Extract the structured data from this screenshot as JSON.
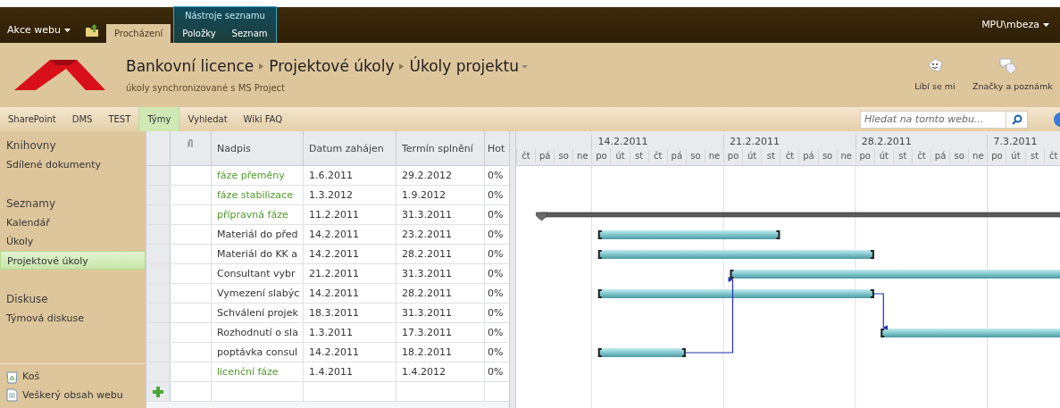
{
  "ribbon": {
    "site_actions": "Akce webu",
    "tabs": [
      {
        "label": "Procházení",
        "selected": true
      },
      {
        "label": "Položky",
        "selected": false
      },
      {
        "label": "Seznam",
        "selected": false
      }
    ],
    "tool_group": "Nástroje seznamu",
    "user": "MPU\\mbeza"
  },
  "header": {
    "breadcrumb": [
      "Bankovní licence",
      "Projektové úkoly",
      "Úkoly projektu"
    ],
    "subtitle": "úkoly synchronizované s MS Project",
    "actions": [
      "Líbí se mi",
      "Značky a poznámk"
    ]
  },
  "top_nav": {
    "items": [
      {
        "label": "SharePoint",
        "selected": false
      },
      {
        "label": "DMS",
        "selected": false
      },
      {
        "label": "TEST",
        "selected": false
      },
      {
        "label": "Týmy",
        "selected": true
      },
      {
        "label": "Vyhledat",
        "selected": false
      },
      {
        "label": "Wiki FAQ",
        "selected": false
      }
    ],
    "search": {
      "placeholder": "Hledat na tomto webu..."
    }
  },
  "sidebar": {
    "sections": [
      {
        "heading": "Knihovny",
        "items": [
          {
            "label": "Sdílené dokumenty",
            "selected": false
          }
        ]
      },
      {
        "heading": "Seznamy",
        "items": [
          {
            "label": "Kalendář",
            "selected": false
          },
          {
            "label": "Úkoly",
            "selected": false
          },
          {
            "label": "Projektové úkoly",
            "selected": true
          }
        ]
      },
      {
        "heading": "Diskuse",
        "items": [
          {
            "label": "Týmová diskuse",
            "selected": false
          }
        ]
      }
    ],
    "footer": [
      {
        "label": "Koš",
        "kind": "bin"
      },
      {
        "label": "Veškerý obsah webu",
        "kind": "document"
      }
    ]
  },
  "table": {
    "columns": [
      "Nadpis",
      "Datum zahájen",
      "Termín splnění",
      "Hot"
    ],
    "rows": [
      {
        "kind": "summary",
        "title": "fáze přeměny",
        "start": "1.6.2011",
        "due": "29.2.2012",
        "done": "0%"
      },
      {
        "kind": "summary",
        "title": "fáze stabilizace",
        "start": "1.3.2012",
        "due": "1.9.2012",
        "done": "0%"
      },
      {
        "kind": "summary",
        "title": "přípravná fáze",
        "start": "11.2.2011",
        "due": "31.3.2011",
        "done": "0%"
      },
      {
        "kind": "task",
        "title": "Materiál do před",
        "start": "14.2.2011",
        "due": "23.2.2011",
        "done": "0%"
      },
      {
        "kind": "task",
        "title": "Materiál do KK a",
        "start": "14.2.2011",
        "due": "28.2.2011",
        "done": "0%"
      },
      {
        "kind": "task",
        "title": "Consultant vybr",
        "start": "21.2.2011",
        "due": "31.3.2011",
        "done": "0%"
      },
      {
        "kind": "task",
        "title": "Vymezení slabýc",
        "start": "14.2.2011",
        "due": "28.2.2011",
        "done": "0%",
        "linked": true
      },
      {
        "kind": "task",
        "title": "Schválení projek",
        "start": "18.3.2011",
        "due": "31.3.2011",
        "done": "0%"
      },
      {
        "kind": "task",
        "title": "Rozhodnutí o sla",
        "start": "1.3.2011",
        "due": "17.3.2011",
        "done": "0%"
      },
      {
        "kind": "task",
        "title": "poptávka consul",
        "start": "14.2.2011",
        "due": "18.2.2011",
        "done": "0%",
        "linked": true
      },
      {
        "kind": "summary",
        "title": "licenční fáze",
        "start": "1.4.2011",
        "due": "1.4.2012",
        "done": "0%"
      }
    ]
  },
  "gantt": {
    "weeks": [
      "14.2.2011",
      "21.2.2011",
      "28.2.2011",
      "7.3.2011"
    ],
    "days": [
      "čt",
      "pá",
      "so",
      "ne",
      "po",
      "út",
      "st",
      "čt",
      "pá",
      "so",
      "ne",
      "po",
      "út",
      "st",
      "čt",
      "pá",
      "so",
      "ne",
      "po",
      "út",
      "st",
      "čt",
      "pá",
      "so",
      "ne",
      "po",
      "út",
      "st",
      "čt"
    ]
  }
}
